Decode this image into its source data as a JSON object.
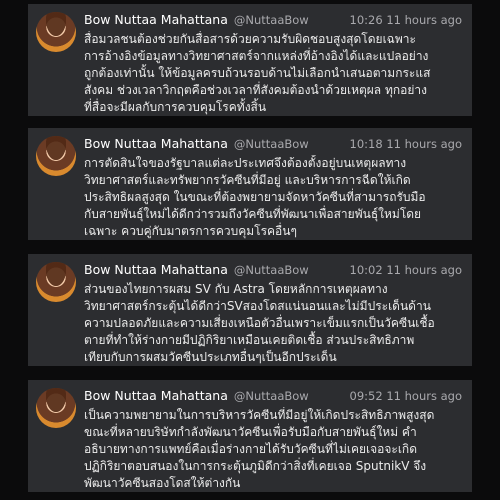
{
  "tweets": [
    {
      "name": "Bow Nuttaa Mahattana",
      "handle": "@NuttaaBow",
      "time": "10:26 11 hours ago",
      "text": "สื่อมวลชนต้องช่วยกันสื่อสารด้วยความรับผิดชอบสูงสุดโดยเฉพาะ\nการอ้างอิงข้อมูลทางวิทยาศาสตร์จากแหล่งที่อ้างอิงได้และแปลอย่าง\nถูกต้องเท่านั้น ให้ข้อมูลครบถ้วนรอบด้านไม่เลือกนำเสนอตามกระแส\nสังคม ช่วงเวลาวิกฤตคือช่วงเวลาที่สังคมต้องนำด้วยเหตุผล ทุกอย่าง\nที่สื่อจะมีผลกับการควบคุมโรคทั้งสิ้น"
    },
    {
      "name": "Bow Nuttaa Mahattana",
      "handle": "@NuttaaBow",
      "time": "10:18 11 hours ago",
      "text": "การตัดสินใจของรัฐบาลแต่ละประเทศจึงต้องตั้งอยู่บนเหตุผลทาง\nวิทยาศาสตร์และทรัพยากรวัคซีนที่มีอยู่ และบริหารการฉีดให้เกิด\nประสิทธิผลสูงสุด ในขณะที่ต้องพยายามจัดหาวัคซีนที่สามารถรับมือ\nกับสายพันธุ์ใหม่ได้ดีกว่ารวมถึงวัคซีนที่พัฒนาเพื่อสายพันธุ์ใหม่โดย\nเฉพาะ ควบคู่กับมาตรการควบคุมโรคอื่นๆ"
    },
    {
      "name": "Bow Nuttaa Mahattana",
      "handle": "@NuttaaBow",
      "time": "10:02 11 hours ago",
      "text": "ส่วนของไทยการผสม SV กับ Astra โดยหลักการเหตุผลทาง\nวิทยาศาสตร์กระตุ้นได้ดีกว่าSVสองโดสแน่นอนและไม่มีประเด็นด้าน\nความปลอดภัยและความเสี่ยงเหนือตัวอื่นเพราะเข็มแรกเป็นวัคซีนเชื้อ\nตายที่ทำให้ร่างกายมีปฏิกิริยาเหมือนเคยติดเชื้อ ส่วนประสิทธิภาพ\nเทียบกับการผสมวัคซีนประเภทอื่นๆเป็นอีกประเด็น"
    },
    {
      "name": "Bow Nuttaa Mahattana",
      "handle": "@NuttaaBow",
      "time": "09:52 11 hours ago",
      "text": "เป็นความพยายามในการบริหารวัคซีนที่มีอยู่ให้เกิดประสิทธิภาพสูงสุด\nขณะที่หลายบริษัทกำลังพัฒนาวัคซีนเพื่อรับมือกับสายพันธุ์ใหม่ คำ\nอธิบายทางการแพทย์คือเมื่อร่างกายได้รับวัคซีนที่ไม่เคยเจอจะเกิด\nปฏิกิริยาตอบสนองในการกระตุ้นภูมิดีกว่าสิ่งที่เคยเจอ SputnikV จึง\nพัฒนาวัคซีนสองโดสให้ต่างกัน"
    }
  ]
}
